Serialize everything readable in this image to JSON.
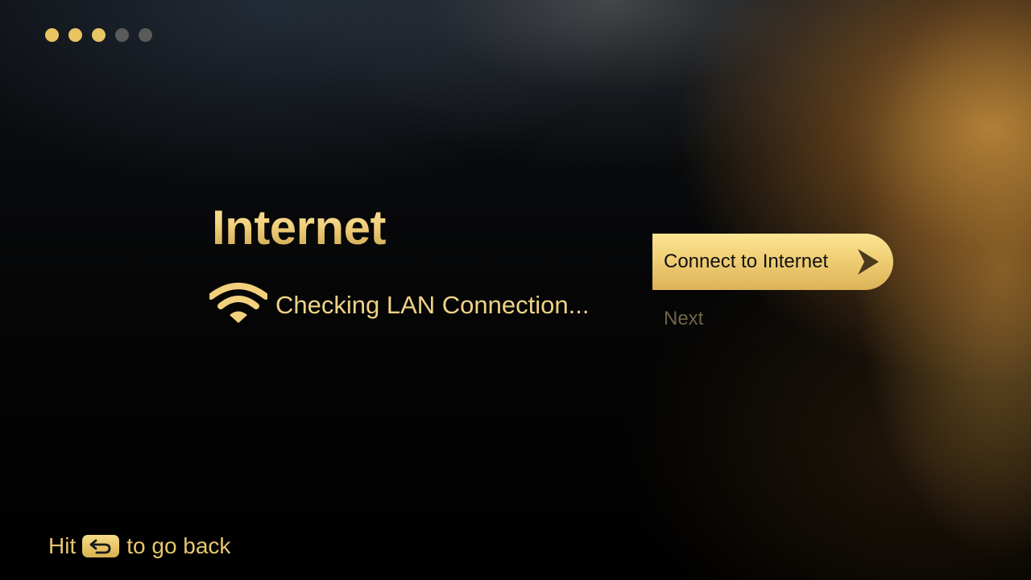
{
  "progress": {
    "total_steps": 5,
    "completed_steps": 3,
    "active_color": "#e8c562",
    "inactive_color": "#5a5a5a"
  },
  "page": {
    "title": "Internet",
    "status_icon": "wifi-icon",
    "status_text": "Checking LAN Connection..."
  },
  "actions": {
    "connect_label": "Connect to Internet",
    "connect_icon": "chevron-right-icon",
    "next_label": "Next",
    "accent_color": "#f2d179"
  },
  "footer": {
    "hint_prefix": "Hit",
    "back_key_icon": "return-icon",
    "hint_suffix": "to go back"
  }
}
